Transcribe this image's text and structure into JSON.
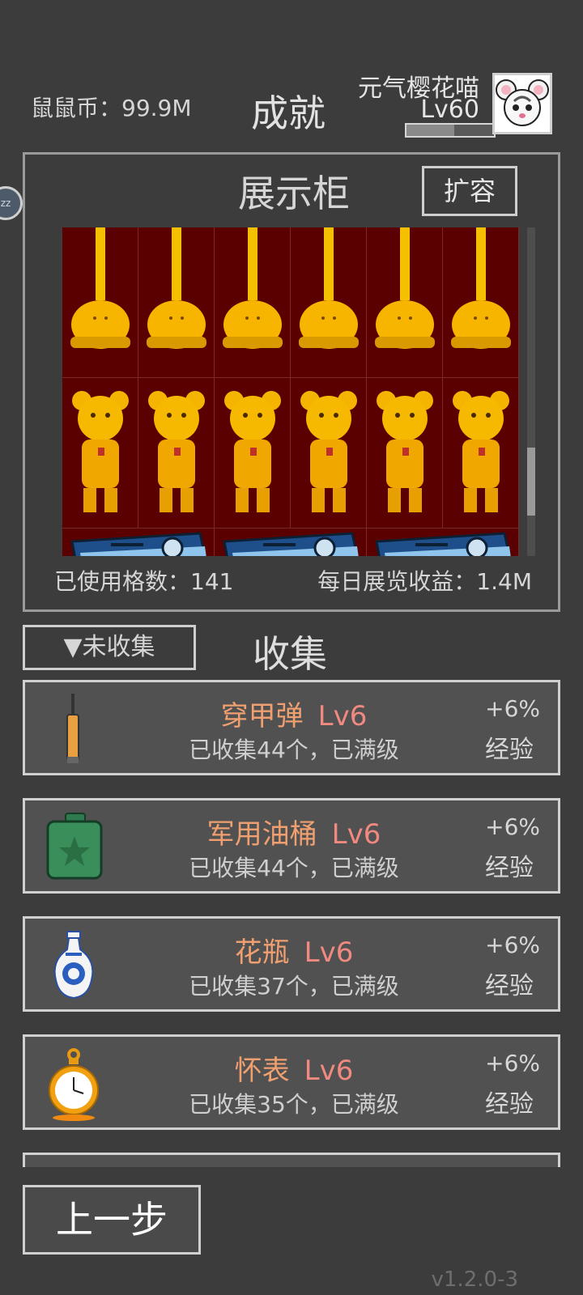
{
  "header": {
    "coins_label": "鼠鼠币：99.9M",
    "title": "成就",
    "player_name": "元气樱花喵",
    "player_level": "Lv60",
    "xp_fraction": 0.55
  },
  "cabinet": {
    "title": "展示柜",
    "expand_label": "扩容",
    "used_slots": "已使用格数：141",
    "daily_income": "每日展览收益：1.4M",
    "rows": [
      {
        "item": "trophy-icon",
        "count": 6
      },
      {
        "item": "bear-statue-icon",
        "count": 6
      },
      {
        "item": "projector-icon",
        "count": 3
      }
    ]
  },
  "collection": {
    "filter_label": "▼未收集",
    "title": "收集",
    "items": [
      {
        "name": "穿甲弹",
        "level": "Lv6",
        "status": "已收集44个，已满级",
        "bonus": "+6%",
        "bonus_type": "经验",
        "icon": "bullet-icon"
      },
      {
        "name": "军用油桶",
        "level": "Lv6",
        "status": "已收集44个，已满级",
        "bonus": "+6%",
        "bonus_type": "经验",
        "icon": "jerrycan-icon"
      },
      {
        "name": "花瓶",
        "level": "Lv6",
        "status": "已收集37个，已满级",
        "bonus": "+6%",
        "bonus_type": "经验",
        "icon": "vase-icon"
      },
      {
        "name": "怀表",
        "level": "Lv6",
        "status": "已收集35个，已满级",
        "bonus": "+6%",
        "bonus_type": "经验",
        "icon": "pocket-watch-icon"
      }
    ]
  },
  "footer": {
    "back_label": "上一步",
    "version": "v1.2.0-3"
  },
  "colors": {
    "background": "#3c3c3c",
    "item_name": "#f0a070",
    "item_level": "#f08a80",
    "cabinet_bg": "#5b0000"
  }
}
